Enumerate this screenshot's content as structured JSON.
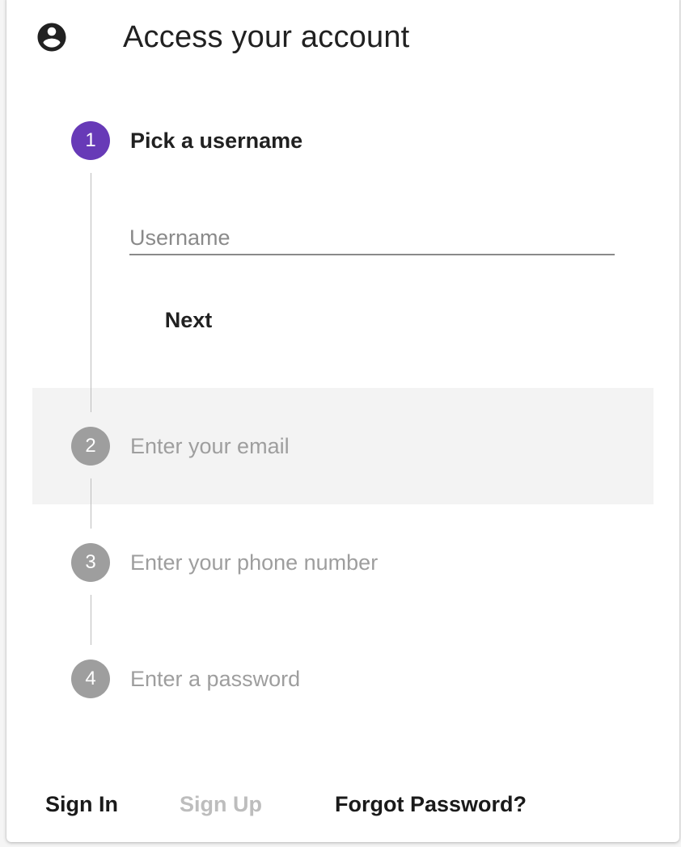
{
  "header": {
    "icon": "account-circle-icon",
    "title": "Access your account"
  },
  "stepper": {
    "active_color": "#673ab7",
    "inactive_color": "#9e9e9e",
    "steps": [
      {
        "number": "1",
        "label": "Pick a username",
        "state": "active"
      },
      {
        "number": "2",
        "label": "Enter your email",
        "state": "inactive"
      },
      {
        "number": "3",
        "label": "Enter your phone number",
        "state": "inactive"
      },
      {
        "number": "4",
        "label": "Enter a password",
        "state": "inactive"
      }
    ]
  },
  "username_step": {
    "input_placeholder": "Username",
    "input_value": "",
    "next_label": "Next"
  },
  "footer": {
    "sign_in_label": "Sign In",
    "sign_up_label": "Sign Up",
    "forgot_password_label": "Forgot Password?"
  }
}
